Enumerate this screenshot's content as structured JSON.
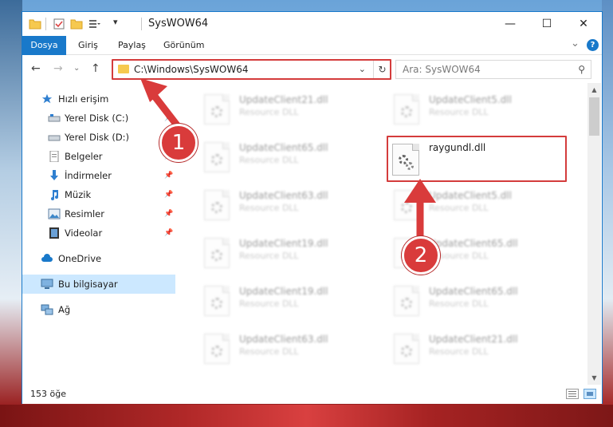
{
  "window": {
    "title": "SysWOW64",
    "minimize": "—",
    "maximize": "☐",
    "close": "✕"
  },
  "ribbon": {
    "tabs": [
      "Dosya",
      "Giriş",
      "Paylaş",
      "Görünüm"
    ],
    "expand": "⌄",
    "help": "?"
  },
  "address": {
    "path": "C:\\Windows\\SysWOW64",
    "dropdown": "⌄",
    "refresh": "↻"
  },
  "nav": {
    "back": "←",
    "forward": "→",
    "recent": "⌄",
    "up": "↑"
  },
  "search": {
    "placeholder": "Ara: SysWOW64",
    "icon": "⚲"
  },
  "sidebar": {
    "items": [
      {
        "label": "Hızlı erişim",
        "icon": "star-icon",
        "pinned": false
      },
      {
        "label": "Yerel Disk (C:)",
        "icon": "drive-icon",
        "pinned": true
      },
      {
        "label": "Yerel Disk (D:)",
        "icon": "drive-icon",
        "pinned": true
      },
      {
        "label": "Belgeler",
        "icon": "documents-icon",
        "pinned": true
      },
      {
        "label": "İndirmeler",
        "icon": "download-icon",
        "pinned": true
      },
      {
        "label": "Müzik",
        "icon": "music-icon",
        "pinned": true
      },
      {
        "label": "Resimler",
        "icon": "pictures-icon",
        "pinned": true
      },
      {
        "label": "Videolar",
        "icon": "videos-icon",
        "pinned": true
      },
      {
        "label": "OneDrive",
        "icon": "cloud-icon",
        "pinned": false
      },
      {
        "label": "Bu bilgisayar",
        "icon": "computer-icon",
        "pinned": false,
        "selected": true
      },
      {
        "label": "Ağ",
        "icon": "network-icon",
        "pinned": false
      }
    ]
  },
  "files": {
    "type_label": "Resource DLL",
    "highlighted": {
      "name": "raygundl.dll"
    },
    "left_column": [
      "UpdateClient21.dll",
      "UpdateClient65.dll",
      "UpdateClient63.dll",
      "UpdateClient19.dll",
      "UpdateClient19.dll",
      "UpdateClient63.dll"
    ],
    "right_column": [
      "UpdateClient5.dll",
      "UpdateClient5.dll",
      "UpdateClient65.dll",
      "UpdateClient65.dll",
      "UpdateClient21.dll"
    ]
  },
  "status": {
    "count": "153 öğe"
  },
  "annotations": {
    "badge1": "1",
    "badge2": "2",
    "color": "#d93b3b"
  }
}
